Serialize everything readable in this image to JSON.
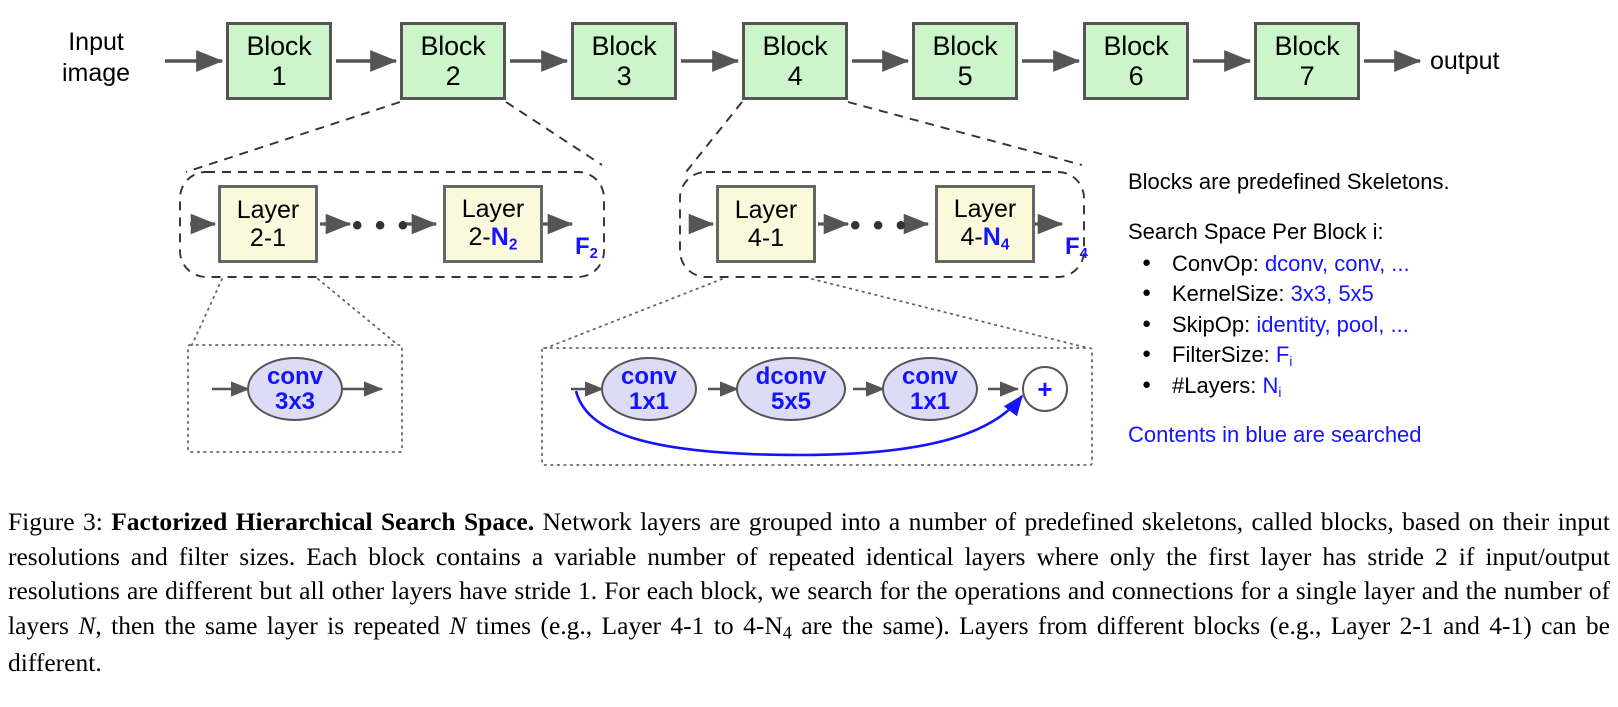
{
  "figure": {
    "input_label_line1": "Input",
    "input_label_line2": "image",
    "output_label": "output"
  },
  "blocks": [
    {
      "name": "Block",
      "number": "1"
    },
    {
      "name": "Block",
      "number": "2"
    },
    {
      "name": "Block",
      "number": "3"
    },
    {
      "name": "Block",
      "number": "4"
    },
    {
      "name": "Block",
      "number": "5"
    },
    {
      "name": "Block",
      "number": "6"
    },
    {
      "name": "Block",
      "number": "7"
    }
  ],
  "block_groups": [
    {
      "id": "block2",
      "first_layer": {
        "name": "Layer",
        "index_prefix": "2-",
        "index_value": "1",
        "index_searched": false
      },
      "last_layer": {
        "name": "Layer",
        "index_prefix": "2-",
        "index_value": "N",
        "index_sub": "2",
        "index_searched": true
      },
      "ellipsis": "• • •",
      "filter_label": "F",
      "filter_sub": "2"
    },
    {
      "id": "block4",
      "first_layer": {
        "name": "Layer",
        "index_prefix": "4-",
        "index_value": "1",
        "index_searched": false
      },
      "last_layer": {
        "name": "Layer",
        "index_prefix": "4-",
        "index_value": "N",
        "index_sub": "4",
        "index_searched": true
      },
      "ellipsis": "• • •",
      "filter_label": "F",
      "filter_sub": "4"
    }
  ],
  "layer_details": [
    {
      "id": "layer2-detail",
      "ops": [
        {
          "op": "conv",
          "kernel": "3x3"
        }
      ],
      "has_skip": false,
      "add_symbol": "+"
    },
    {
      "id": "layer4-detail",
      "ops": [
        {
          "op": "conv",
          "kernel": "1x1"
        },
        {
          "op": "dconv",
          "kernel": "5x5"
        },
        {
          "op": "conv",
          "kernel": "1x1"
        }
      ],
      "has_skip": true,
      "add_symbol": "+"
    }
  ],
  "info_panel": {
    "headline": "Blocks are predefined Skeletons.",
    "search_space_title": "Search Space Per Block i:",
    "items": [
      {
        "key": "ConvOp: ",
        "value": "dconv, conv, ..."
      },
      {
        "key": "KernelSize: ",
        "value": "3x3, 5x5"
      },
      {
        "key": "SkipOp: ",
        "value": "identity, pool, ..."
      },
      {
        "key": "FilterSize: ",
        "value": "F",
        "value_sub": "i"
      },
      {
        "key": "#Layers: ",
        "value": "N",
        "value_sub": "i"
      }
    ],
    "footnote": "Contents in blue are searched"
  },
  "caption": {
    "figure_number": "Figure 3: ",
    "title": "Factorized Hierarchical Search Space.",
    "body_part1": " Network layers are grouped into a number of predefined skeletons, called blocks, based on their input resolutions and filter sizes. Each block contains a variable number of repeated identical layers where only the first layer has stride 2 if input/output resolutions are different but all other layers have stride 1. For each block, we search for the operations and connections for a single layer and the number of layers ",
    "math_n1": "N",
    "body_part2": ", then the same layer is repeated ",
    "math_n2": "N",
    "body_part3": " times (e.g., Layer 4-1 to 4-N",
    "caption_sub": "4",
    "body_part4": " are the same). Layers from different blocks (e.g., Layer 2-1 and 4-1) can be different."
  },
  "colors": {
    "block_fill": "#ccf5cc",
    "layer_fill": "#fbf8dc",
    "oval_fill": "#dcdcf7",
    "searched_blue": "#1414ff",
    "stroke_gray": "#555555"
  }
}
